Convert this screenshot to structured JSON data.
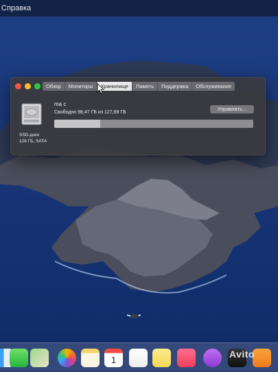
{
  "menubar": {
    "item": "Справка"
  },
  "window": {
    "tabs": [
      {
        "label": "Обзор",
        "active": false
      },
      {
        "label": "Мониторы",
        "active": false
      },
      {
        "label": "Хранилище",
        "active": true
      },
      {
        "label": "Память",
        "active": false
      },
      {
        "label": "Поддержка",
        "active": false
      },
      {
        "label": "Обслуживание",
        "active": false
      }
    ],
    "volume_name": "ma c",
    "free_text": "Свободно 98,47 ГБ из 127,69 ГБ",
    "disk_type": "SSD-диск",
    "disk_info": "128 ГБ, SATA",
    "manage_label": "Управлять...",
    "used_fraction": 0.23
  },
  "dock": {
    "icons": [
      "finder-icon",
      "messages-icon",
      "maps-icon",
      "photos-icon",
      "notes-icon",
      "calendar-icon",
      "reminders-icon",
      "stickies-icon",
      "music-icon",
      "podcasts-icon",
      "tv-icon",
      "books-icon"
    ],
    "calendar_day": "1"
  },
  "watermark": "Avito",
  "colors": {
    "close": "#f3564d",
    "minimize": "#f5bb2f",
    "maximize": "#2cc840"
  }
}
